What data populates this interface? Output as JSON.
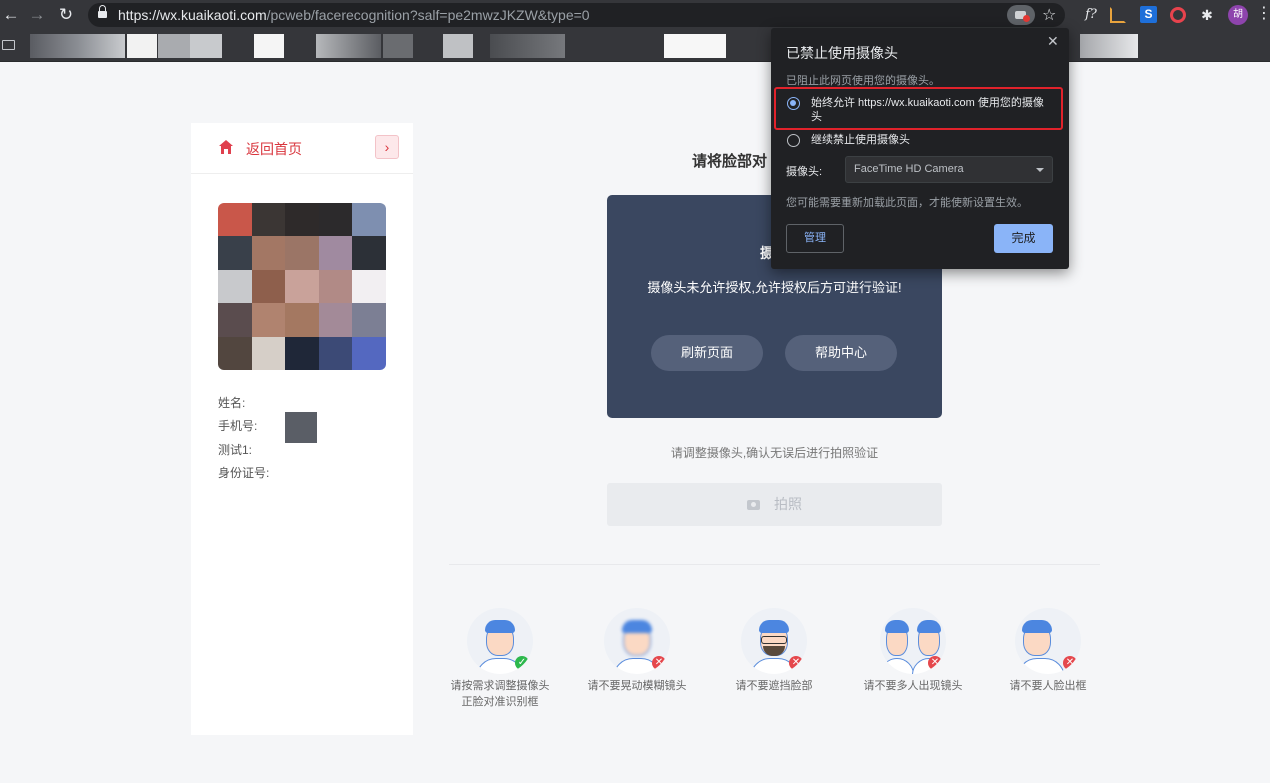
{
  "browser": {
    "url_host": "https://wx.kuaikaoti.com",
    "url_path": "/pcweb/facerecognition?salf=pe2mwzJKZW&type=0",
    "avatar_letter": "胡",
    "ext_fx": "f?",
    "ext_s": "S"
  },
  "sidebar": {
    "home_label": "返回首页",
    "fields": {
      "name_label": "姓名:",
      "phone_label": "手机号:",
      "test_label": "测试1:",
      "id_label": "身份证号:"
    }
  },
  "main": {
    "title": "请将脸部对",
    "video_heading": "摄",
    "video_message": "摄像头未允许授权,允许授权后方可进行验证!",
    "refresh_button": "刷新页面",
    "help_button": "帮助中心",
    "hint": "请调整摄像头,确认无误后进行拍照验证",
    "shoot_button": "拍照"
  },
  "tips": [
    {
      "line1": "请按需求调整摄像头",
      "line2": "正脸对准识别框",
      "status": "ok"
    },
    {
      "line1": "请不要晃动模糊镜头",
      "line2": "",
      "status": "no"
    },
    {
      "line1": "请不要遮挡脸部",
      "line2": "",
      "status": "no"
    },
    {
      "line1": "请不要多人出现镜头",
      "line2": "",
      "status": "no"
    },
    {
      "line1": "请不要人脸出框",
      "line2": "",
      "status": "no"
    }
  ],
  "popup": {
    "title": "已禁止使用摄像头",
    "subtitle": "已阻止此网页使用您的摄像头。",
    "option_allow": "始终允许 https://wx.kuaikaoti.com 使用您的摄像头",
    "option_block": "继续禁止使用摄像头",
    "camera_label": "摄像头:",
    "camera_selected": "FaceTime HD Camera",
    "note": "您可能需要重新加载此页面，才能使新设置生效。",
    "manage_button": "管理",
    "done_button": "完成"
  },
  "colors": {
    "accent_red": "#d9363e",
    "video_bg": "#3a4760",
    "popup_bg": "#202124",
    "popup_accent": "#8ab4f8",
    "highlight_border": "#e1222b"
  }
}
